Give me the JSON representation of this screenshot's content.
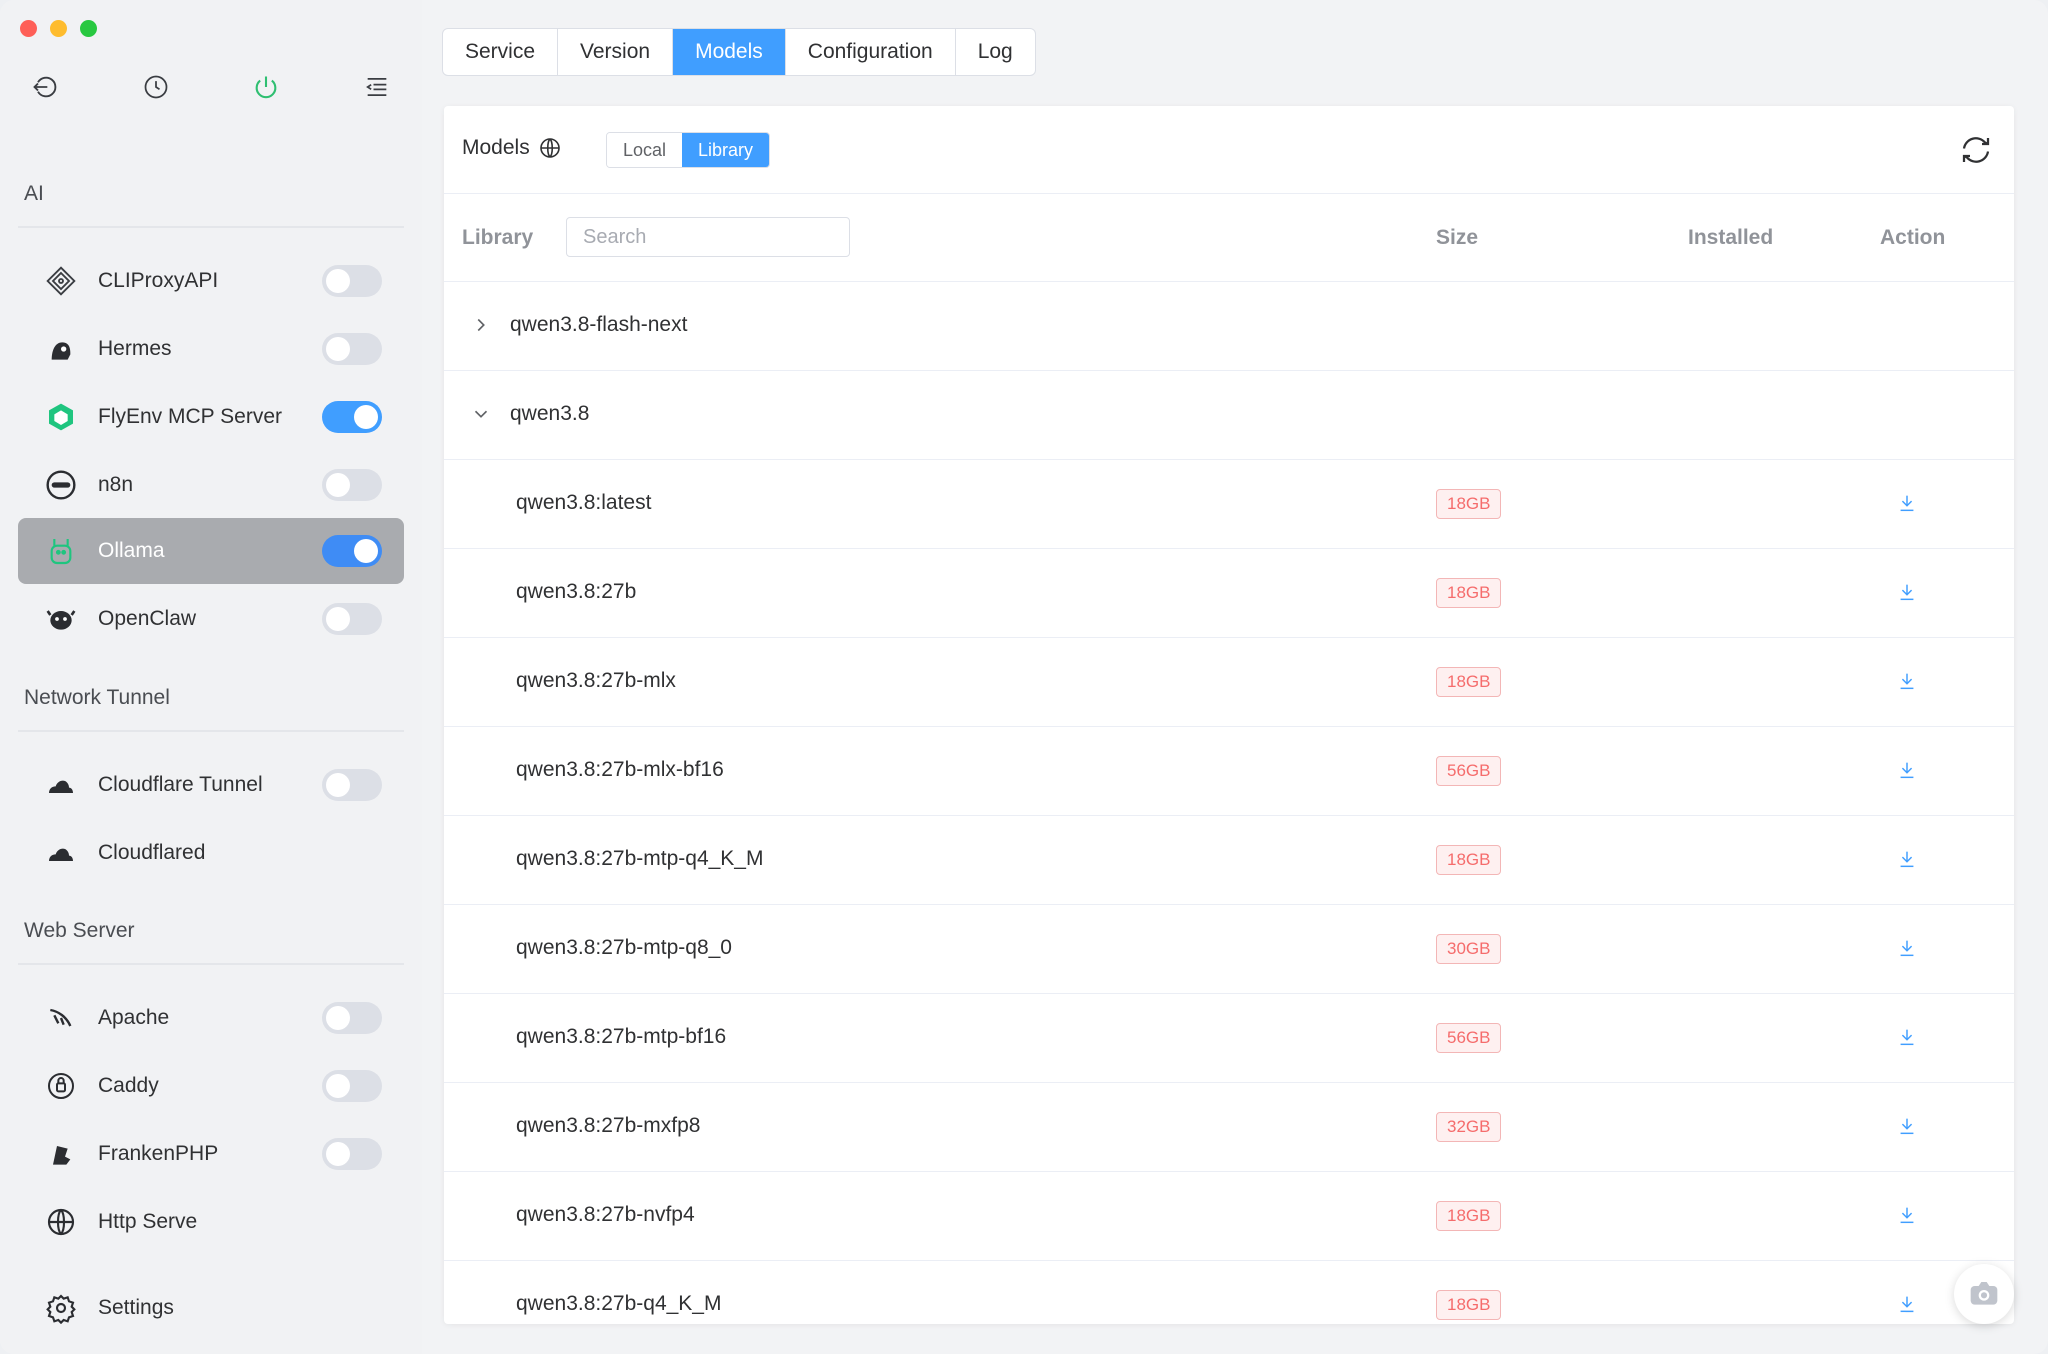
{
  "sidebar": {
    "sections": {
      "ai": "AI",
      "network_tunnel": "Network Tunnel",
      "web_server": "Web Server"
    },
    "items": {
      "cliproxyapi": {
        "label": "CLIProxyAPI",
        "enabled": false
      },
      "hermes": {
        "label": "Hermes",
        "enabled": false
      },
      "flyenv_mcp": {
        "label": "FlyEnv MCP Server",
        "enabled": true
      },
      "n8n": {
        "label": "n8n",
        "enabled": false
      },
      "ollama": {
        "label": "Ollama",
        "enabled": true,
        "active": true
      },
      "openclaw": {
        "label": "OpenClaw",
        "enabled": false
      },
      "cloudflare_tunnel": {
        "label": "Cloudflare Tunnel",
        "enabled": false
      },
      "cloudflared": {
        "label": "Cloudflared"
      },
      "apache": {
        "label": "Apache",
        "enabled": false
      },
      "caddy": {
        "label": "Caddy",
        "enabled": false
      },
      "frankenphp": {
        "label": "FrankenPHP",
        "enabled": false
      },
      "http_serve": {
        "label": "Http Serve"
      },
      "settings": {
        "label": "Settings"
      }
    }
  },
  "tabs": {
    "service": "Service",
    "version": "Version",
    "models": "Models",
    "configuration": "Configuration",
    "log": "Log",
    "active": "Models"
  },
  "panel": {
    "title": "Models",
    "segment": {
      "local": "Local",
      "library": "Library",
      "active": "Library"
    }
  },
  "table": {
    "headers": {
      "library": "Library",
      "size": "Size",
      "installed": "Installed",
      "action": "Action"
    },
    "search_placeholder": "Search",
    "groups": [
      {
        "name": "qwen3.8-flash-next",
        "expanded": false
      },
      {
        "name": "qwen3.8",
        "expanded": true
      }
    ],
    "rows": [
      {
        "name": "qwen3.8:latest",
        "size": "18GB"
      },
      {
        "name": "qwen3.8:27b",
        "size": "18GB"
      },
      {
        "name": "qwen3.8:27b-mlx",
        "size": "18GB"
      },
      {
        "name": "qwen3.8:27b-mlx-bf16",
        "size": "56GB"
      },
      {
        "name": "qwen3.8:27b-mtp-q4_K_M",
        "size": "18GB"
      },
      {
        "name": "qwen3.8:27b-mtp-q8_0",
        "size": "30GB"
      },
      {
        "name": "qwen3.8:27b-mtp-bf16",
        "size": "56GB"
      },
      {
        "name": "qwen3.8:27b-mxfp8",
        "size": "32GB"
      },
      {
        "name": "qwen3.8:27b-nvfp4",
        "size": "18GB"
      },
      {
        "name": "qwen3.8:27b-q4_K_M",
        "size": "18GB"
      }
    ]
  },
  "colors": {
    "accent": "#409eff",
    "danger": "#f56c6c",
    "power": "#2fbf71"
  }
}
